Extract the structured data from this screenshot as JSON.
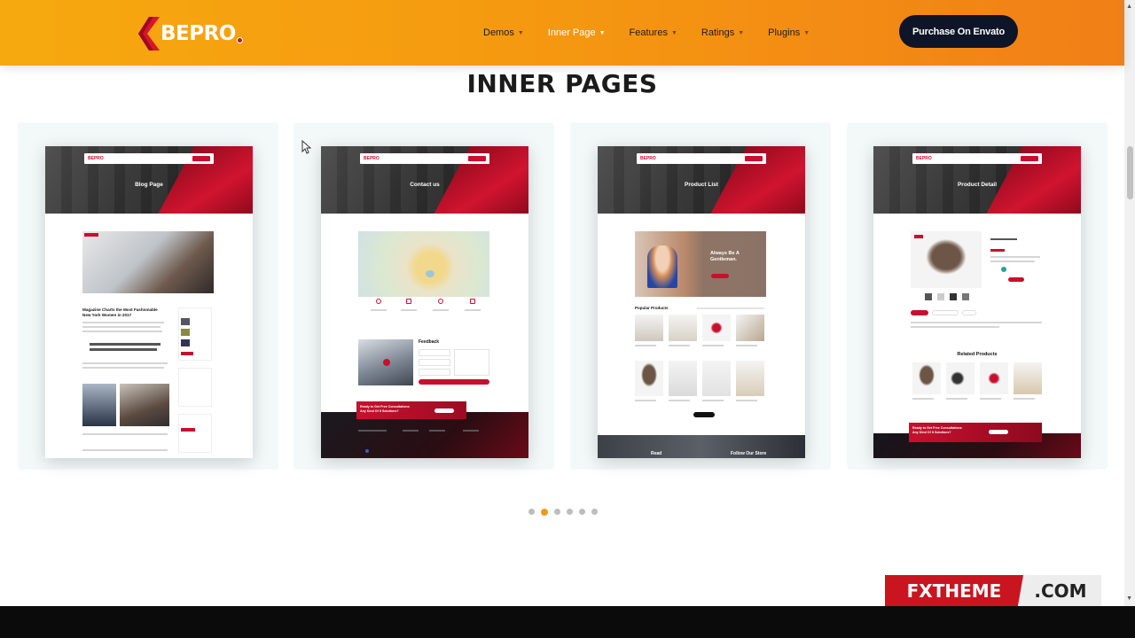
{
  "header": {
    "logo_text": "BEPRO",
    "nav": [
      {
        "label": "Demos",
        "active": false
      },
      {
        "label": "Inner Page",
        "active": true
      },
      {
        "label": "Features",
        "active": false
      },
      {
        "label": "Ratings",
        "active": false
      },
      {
        "label": "Plugins",
        "active": false
      }
    ],
    "purchase_label": "Purchase On Envato"
  },
  "section": {
    "title": "INNER PAGES"
  },
  "cards": [
    {
      "title": "Blog Page",
      "headline": "Magazine Charts the Most Fashionable New York Women in 2017"
    },
    {
      "title": "Contact us",
      "feedback": "Feedback",
      "cta": "Ready to Get Free Consultations Any Kind Of It Solutions?"
    },
    {
      "title": "Product List",
      "promo_heading": "Always Be A Gentleman.",
      "popular": "Popular Products",
      "footer_left": "Read",
      "footer_right": "Follow Our Store"
    },
    {
      "title": "Product Detail",
      "related": "Related Products",
      "cta": "Ready to Get Free Consultations Any Kind Of It Solutions?"
    }
  ],
  "carousel": {
    "count": 6,
    "active_index": 1
  },
  "watermark": {
    "left": "FXTHEME",
    "right": ".COM"
  },
  "colors": {
    "accent_orange": "#f59a10",
    "brand_red": "#c8102e",
    "dark_navy": "#0e1528"
  }
}
